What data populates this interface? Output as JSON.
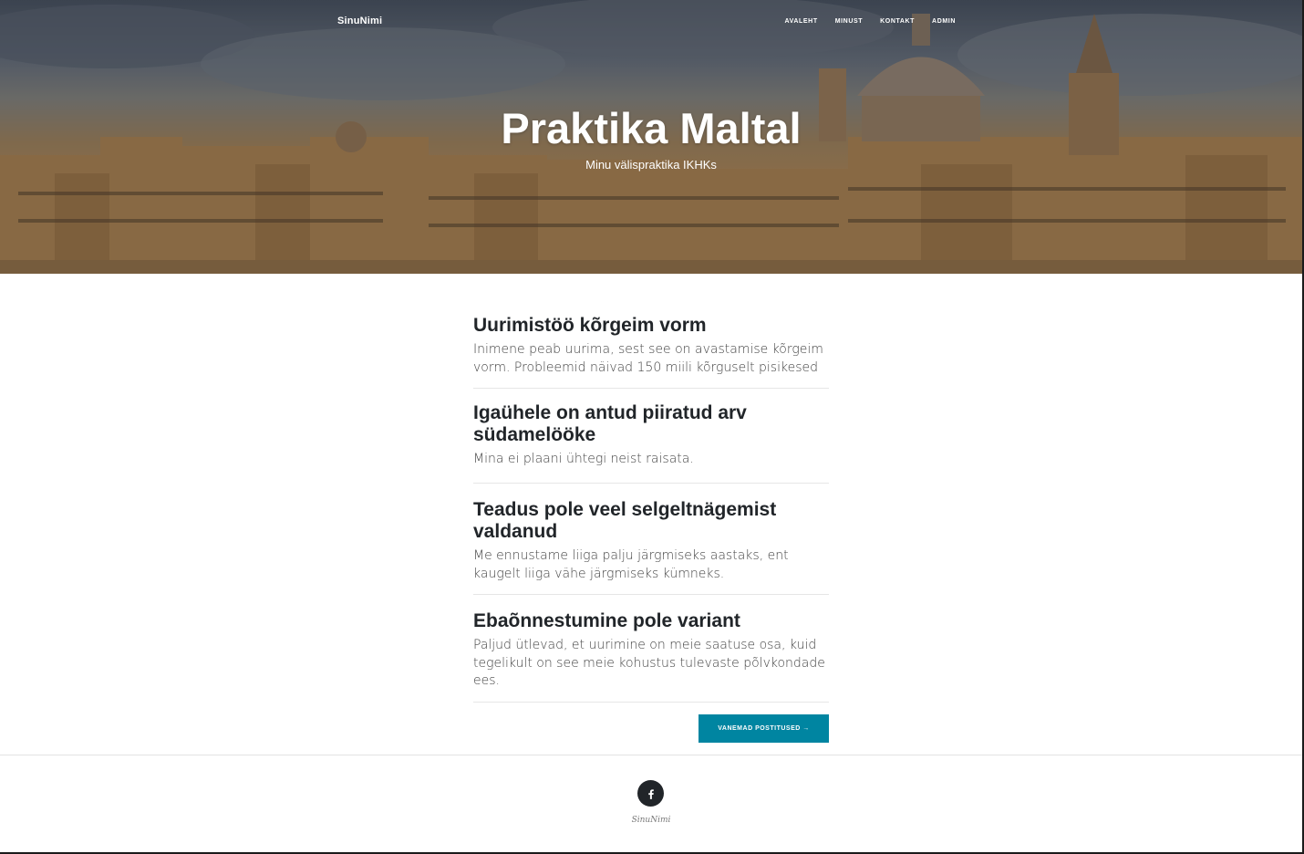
{
  "header": {
    "brand": "SinuNimi",
    "nav": [
      "AVALEHT",
      "MINUST",
      "KONTAKT",
      "ADMIN"
    ],
    "title": "Praktika Maltal",
    "subtitle": "Minu välispraktika IKHKs"
  },
  "posts": [
    {
      "title": "Uurimistöö kõrgeim vorm",
      "excerpt": "Inimene peab uurima, sest see on avastamise kõrgeim vorm. Probleemid näivad 150 miili kõrguselt pisikesed"
    },
    {
      "title": "Igaühele on antud piiratud arv südamelööke",
      "excerpt": "Mina ei plaani ühtegi neist raisata."
    },
    {
      "title": "Teadus pole veel selgeltnägemist valdanud",
      "excerpt": "Me ennustame liiga palju järgmiseks aastaks, ent kaugelt liiga vähe järgmiseks kümneks."
    },
    {
      "title": "Ebaõnnestumine pole variant",
      "excerpt": "Paljud ütlevad, et uurimine on meie saatuse osa, kuid tegelikult on see meie kohustus tulevaste põlvkondade ees."
    }
  ],
  "pager": {
    "older_label": "VANEMAD POSTITUSED →"
  },
  "footer": {
    "social_icon": "facebook-icon",
    "copyright": "SinuNimi"
  },
  "colors": {
    "accent": "#0085a1",
    "text": "#212529"
  }
}
